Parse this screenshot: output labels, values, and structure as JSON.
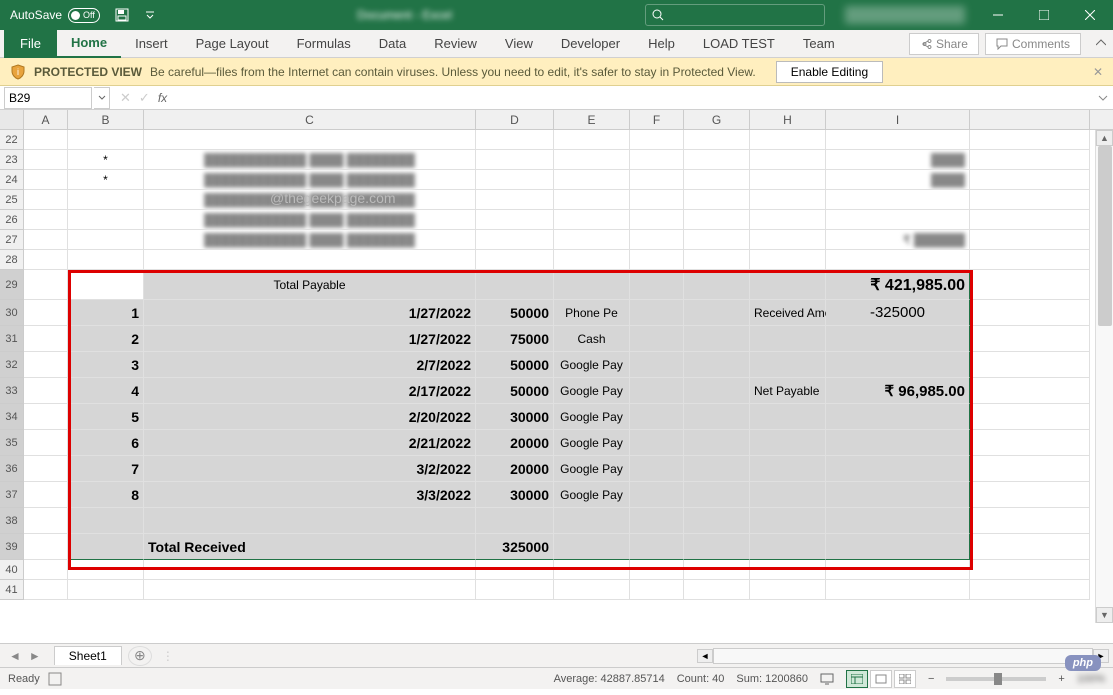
{
  "title_bar": {
    "autosave_label": "AutoSave",
    "autosave_state": "Off"
  },
  "ribbon": {
    "file": "File",
    "tabs": [
      "Home",
      "Insert",
      "Page Layout",
      "Formulas",
      "Data",
      "Review",
      "View",
      "Developer",
      "Help",
      "LOAD TEST",
      "Team"
    ],
    "share": "Share",
    "comments": "Comments"
  },
  "protected_view": {
    "title": "PROTECTED VIEW",
    "message": "Be careful—files from the Internet can contain viruses. Unless you need to edit, it's safer to stay in Protected View.",
    "button": "Enable Editing"
  },
  "name_box": "B29",
  "columns": [
    "A",
    "B",
    "C",
    "D",
    "E",
    "F",
    "G",
    "H",
    "I"
  ],
  "row_numbers": [
    22,
    23,
    24,
    25,
    26,
    27,
    28,
    29,
    30,
    31,
    32,
    33,
    34,
    35,
    36,
    37,
    38,
    39,
    40,
    41
  ],
  "b23": "*",
  "b24": "*",
  "watermark": "@thegeekpage.com",
  "table": {
    "total_payable_label": "Total Payable",
    "total_payable_value": "₹ 421,985.00",
    "received_amount_label": "Received Amount",
    "received_amount_value": "-325000",
    "net_payable_label": "Net Payable",
    "net_payable_value": "₹ 96,985.00",
    "total_received_label": "Total Received",
    "total_received_value": "325000",
    "rows": [
      {
        "n": "1",
        "date": "1/27/2022",
        "amt": "50000",
        "method": "Phone Pe"
      },
      {
        "n": "2",
        "date": "1/27/2022",
        "amt": "75000",
        "method": "Cash"
      },
      {
        "n": "3",
        "date": "2/7/2022",
        "amt": "50000",
        "method": "Google Pay"
      },
      {
        "n": "4",
        "date": "2/17/2022",
        "amt": "50000",
        "method": "Google Pay"
      },
      {
        "n": "5",
        "date": "2/20/2022",
        "amt": "30000",
        "method": "Google Pay"
      },
      {
        "n": "6",
        "date": "2/21/2022",
        "amt": "20000",
        "method": "Google Pay"
      },
      {
        "n": "7",
        "date": "3/2/2022",
        "amt": "20000",
        "method": "Google Pay"
      },
      {
        "n": "8",
        "date": "3/3/2022",
        "amt": "30000",
        "method": "Google Pay"
      }
    ]
  },
  "sheet_tab": "Sheet1",
  "status": {
    "ready": "Ready",
    "average": "Average: 42887.85714",
    "count": "Count: 40",
    "sum": "Sum: 1200860",
    "zoom": "100%"
  }
}
